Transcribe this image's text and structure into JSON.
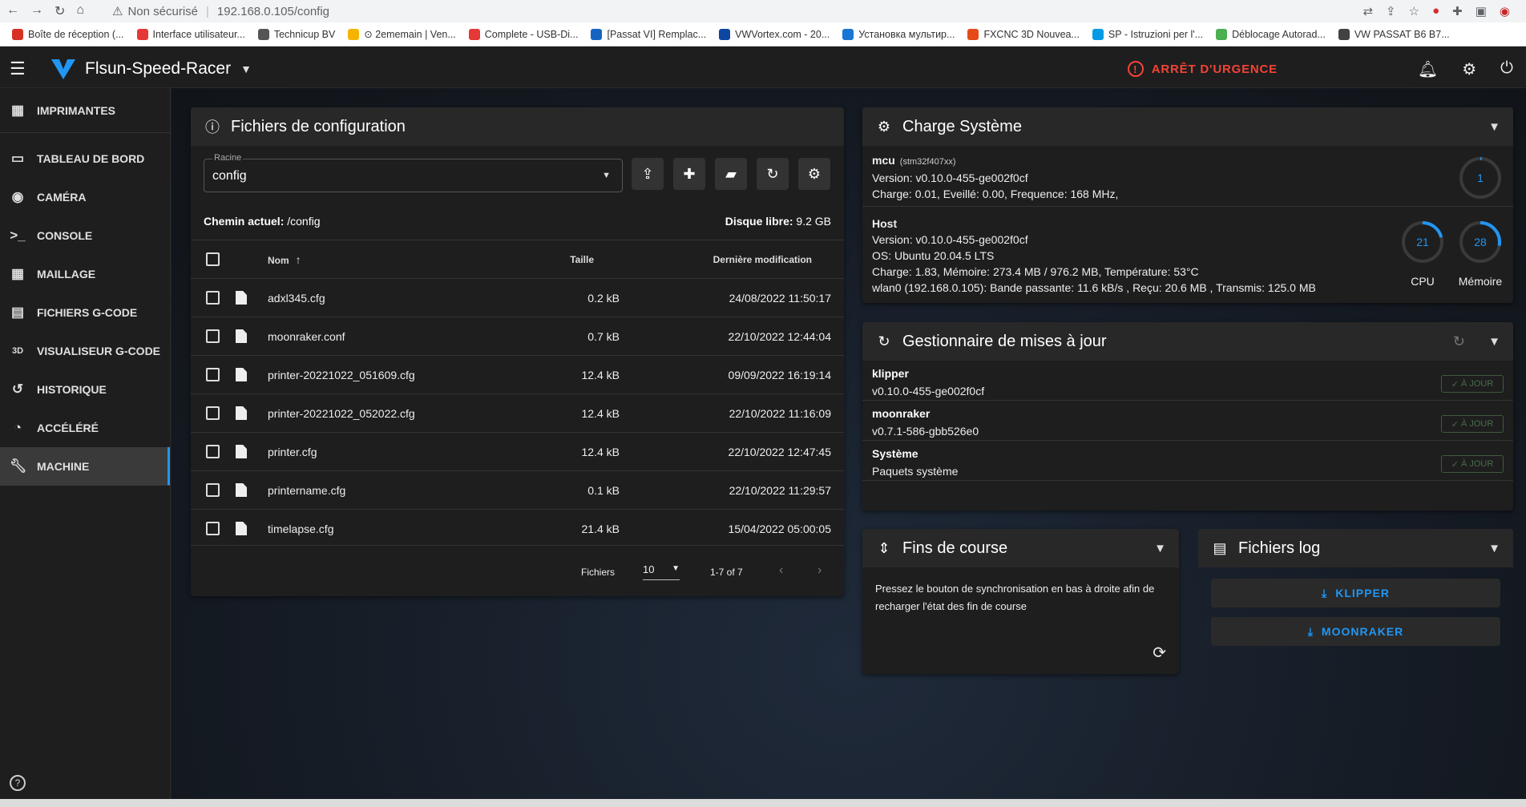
{
  "browser": {
    "insecure_label": "Non sécurisé",
    "url": "192.168.0.105/config",
    "bookmarks": [
      {
        "label": "Boîte de réception (...",
        "color": "#d93025"
      },
      {
        "label": "Interface utilisateur...",
        "color": "#e53935"
      },
      {
        "label": "Technicup BV",
        "color": "#555555"
      },
      {
        "label": "⊙ 2ememain | Ven...",
        "color": "#f4b400"
      },
      {
        "label": "Complete - USB-Di...",
        "color": "#e53935"
      },
      {
        "label": "[Passat VI] Remplac...",
        "color": "#1565c0"
      },
      {
        "label": "VWVortex.com - 20...",
        "color": "#0d47a1"
      },
      {
        "label": "Установка мультир...",
        "color": "#1976d2"
      },
      {
        "label": "FXCNC 3D Nouvea...",
        "color": "#e64a19"
      },
      {
        "label": "SP - Istruzioni per l'...",
        "color": "#039be5"
      },
      {
        "label": "Déblocage Autorad...",
        "color": "#4caf50"
      },
      {
        "label": "VW PASSAT B6 B7...",
        "color": "#424242"
      }
    ]
  },
  "appbar": {
    "printer_name": "Flsun-Speed-Racer",
    "estop_label": "ARRÊT D'URGENCE"
  },
  "sidebar": {
    "items": [
      {
        "label": "IMPRIMANTES",
        "icon": "grid-icon"
      },
      {
        "label": "TABLEAU DE BORD",
        "icon": "dashboard-icon"
      },
      {
        "label": "CAMÉRA",
        "icon": "webcam-icon"
      },
      {
        "label": "CONSOLE",
        "icon": "console-icon"
      },
      {
        "label": "MAILLAGE",
        "icon": "mesh-icon"
      },
      {
        "label": "FICHIERS G-CODE",
        "icon": "file-icon"
      },
      {
        "label": "VISUALISEUR G-CODE",
        "icon": "3d-icon"
      },
      {
        "label": "HISTORIQUE",
        "icon": "history-icon"
      },
      {
        "label": "ACCÉLÉRÉ",
        "icon": "timelapse-icon"
      },
      {
        "label": "MACHINE",
        "icon": "wrench-icon"
      }
    ]
  },
  "config_card": {
    "title": "Fichiers de configuration",
    "root_label": "Racine",
    "root_value": "config",
    "current_path_label": "Chemin actuel:",
    "current_path": "/config",
    "free_disk_label": "Disque libre:",
    "free_disk": "9.2 GB",
    "columns": {
      "name": "Nom",
      "size": "Taille",
      "modified": "Dernière modification"
    },
    "files": [
      {
        "name": "adxl345.cfg",
        "size": "0.2 kB",
        "modified": "24/08/2022 11:50:17"
      },
      {
        "name": "moonraker.conf",
        "size": "0.7 kB",
        "modified": "22/10/2022 12:44:04"
      },
      {
        "name": "printer-20221022_051609.cfg",
        "size": "12.4 kB",
        "modified": "09/09/2022 16:19:14"
      },
      {
        "name": "printer-20221022_052022.cfg",
        "size": "12.4 kB",
        "modified": "22/10/2022 11:16:09"
      },
      {
        "name": "printer.cfg",
        "size": "12.4 kB",
        "modified": "22/10/2022 12:47:45"
      },
      {
        "name": "printername.cfg",
        "size": "0.1 kB",
        "modified": "22/10/2022 11:29:57"
      },
      {
        "name": "timelapse.cfg",
        "size": "21.4 kB",
        "modified": "15/04/2022 05:00:05"
      }
    ],
    "pager": {
      "label": "Fichiers",
      "per_page": "10",
      "range": "1-7 of 7"
    }
  },
  "system_load": {
    "title": "Charge Système",
    "mcu": {
      "name": "mcu",
      "chip": "(stm32f407xx)",
      "version": "Version: v0.10.0-455-ge002f0cf",
      "load": "Charge: 0.01, Eveillé: 0.00, Frequence: 168 MHz,",
      "gauge_value": "1",
      "gauge_percent": 1
    },
    "host": {
      "name": "Host",
      "version": "Version: v0.10.0-455-ge002f0cf",
      "os": "OS: Ubuntu 20.04.5 LTS",
      "load": "Charge: 1.83, Mémoire: 273.4 MB / 976.2 MB, Température: 53°C",
      "network": "wlan0 (192.168.0.105): Bande passante: 11.6 kB/s , Reçu: 20.6 MB , Transmis: 125.0 MB",
      "cpu_value": "21",
      "cpu_percent": 21,
      "cpu_label": "CPU",
      "mem_value": "28",
      "mem_percent": 28,
      "mem_label": "Mémoire"
    }
  },
  "update_manager": {
    "title": "Gestionnaire de mises à jour",
    "items": [
      {
        "name": "klipper",
        "version": "v0.10.0-455-ge002f0cf",
        "status": "À JOUR"
      },
      {
        "name": "moonraker",
        "version": "v0.7.1-586-gbb526e0",
        "status": "À JOUR"
      },
      {
        "name": "Système",
        "version": "Paquets système",
        "status": "À JOUR"
      }
    ]
  },
  "endstops": {
    "title": "Fins de course",
    "text": "Pressez le bouton de synchronisation en bas à droite afin de recharger l'état des fin de course"
  },
  "logs": {
    "title": "Fichiers log",
    "buttons": [
      "KLIPPER",
      "MOONRAKER"
    ]
  },
  "colors": {
    "accent": "#2196f3",
    "estop": "#f44336",
    "ok": "#4a6b4a"
  }
}
